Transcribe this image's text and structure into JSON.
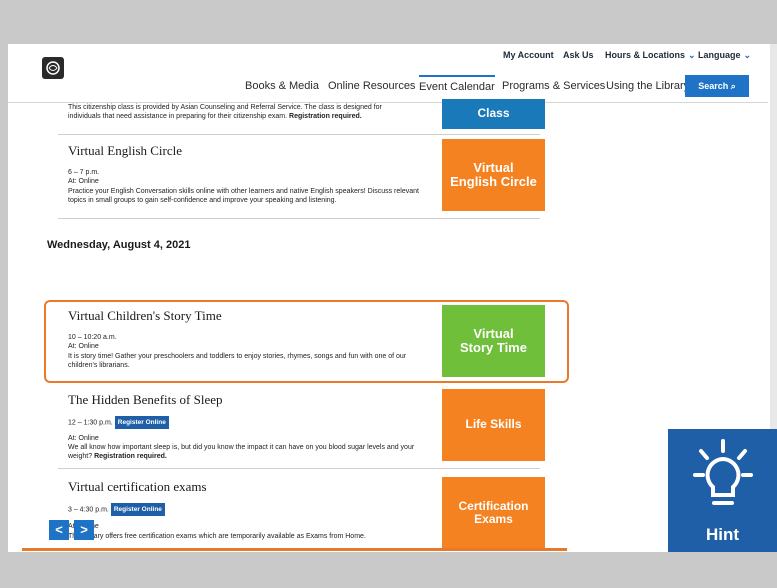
{
  "header": {
    "util": [
      {
        "label": "My Account"
      },
      {
        "label": "Ask Us"
      },
      {
        "label": "Hours & Locations",
        "chevron": "⌄"
      },
      {
        "label": "Language",
        "chevron": "⌄"
      }
    ],
    "nav": [
      {
        "label": "Books & Media"
      },
      {
        "label": "Online Resources"
      },
      {
        "label": "Event Calendar"
      },
      {
        "label": "Programs & Services"
      },
      {
        "label": "Using the Library"
      }
    ],
    "search_label": "Search",
    "search_icon": "⌕"
  },
  "events_prev": {
    "desc_part1": "This citizenship class is provided by Asian Counseling and Referral Service. The class is designed for individuals that need assistance in preparing for their citizenship exam. ",
    "desc_bold": "Registration required.",
    "thumb_label": "Class"
  },
  "event1": {
    "title": "Virtual English Circle",
    "time": "6 – 7 p.m.",
    "location": "At: Online",
    "desc": "Practice your English Conversation skills online with other learners and native English speakers! Discuss relevant topics in small groups to gain self-confidence and improve your speaking and listening.",
    "thumb_line1": "Virtual",
    "thumb_line2": "English Circle"
  },
  "day_heading": "Wednesday, August 4, 2021",
  "event2": {
    "title": "Virtual Children's Story Time",
    "time": "10 – 10:20 a.m.",
    "location": "At: Online",
    "desc": "It is story time! Gather your preschoolers and toddlers to enjoy stories, rhymes, songs and fun with one of our children's librarians.",
    "thumb_line1": "Virtual",
    "thumb_line2": "Story Time"
  },
  "event3": {
    "title": "The Hidden Benefits of Sleep",
    "time": "12 – 1:30 p.m.",
    "register": "Register Online",
    "location": "At: Online",
    "desc": "We all know how important sleep is, but did you know the impact it can have on you blood sugar levels and your weight? ",
    "desc_bold": "Registration required.",
    "thumb_label": "Life Skills"
  },
  "event4": {
    "title": "Virtual certification exams",
    "time": "3 – 4:30 p.m.",
    "register": "Register Online",
    "location": "At: Online",
    "desc": "The Library offers free certification exams which are temporarily available as Exams from Home.",
    "thumb_line1": "Certification",
    "thumb_line2": "Exams"
  },
  "pager": {
    "prev": "<",
    "next": ">"
  },
  "hint": {
    "label": "Hint"
  },
  "colors": {
    "accent": "#1f73c7",
    "orange": "#f58220",
    "green": "#6fbf3a",
    "hint_bg": "#1f5fa8"
  }
}
